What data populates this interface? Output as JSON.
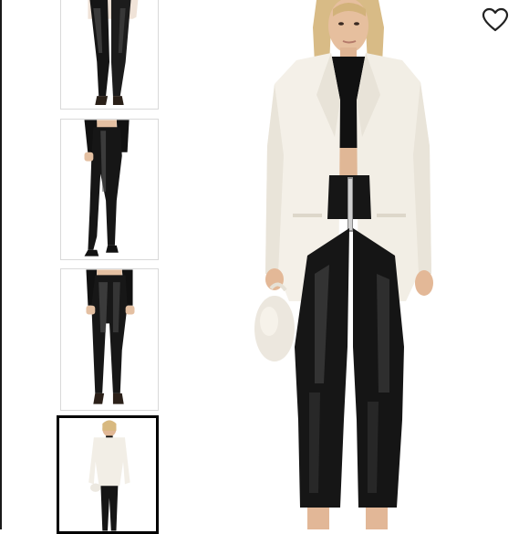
{
  "product": {
    "main_image_icon": "model-white-blazer-black-leather-pants-photo"
  },
  "gallery": {
    "thumbnails": [
      {
        "icon": "black-leather-pants-front-thumbnail",
        "selected": false
      },
      {
        "icon": "black-leather-pants-side-thumbnail",
        "selected": false
      },
      {
        "icon": "black-leather-pants-back-thumbnail",
        "selected": false
      },
      {
        "icon": "white-blazer-outfit-thumbnail",
        "selected": true
      }
    ]
  },
  "actions": {
    "wishlist_icon": "heart-icon"
  },
  "colors": {
    "pants": "#141414",
    "blazer": "#f3efe6",
    "skin": "#e2b99a",
    "selected_border": "#000000"
  }
}
